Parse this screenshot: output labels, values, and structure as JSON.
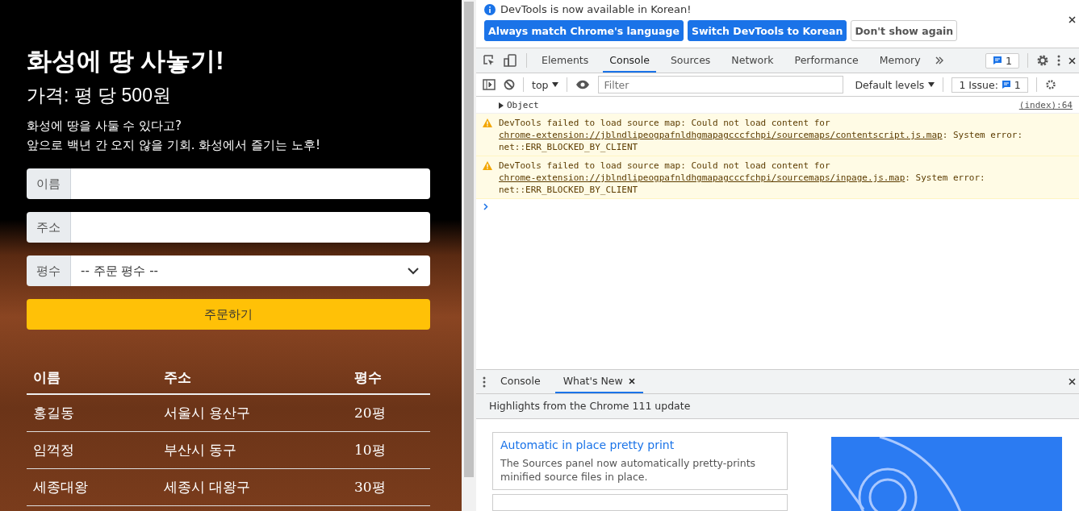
{
  "page": {
    "title": "화성에 땅 사놓기!",
    "price": "가격: 평 당 500원",
    "intro_lines": [
      "화성에 땅을 사둘 수 있다고?",
      "앞으로 백년 간 오지 않을 기회. 화성에서 즐기는 노후!"
    ],
    "fields": [
      {
        "kind": "text",
        "label": "이름"
      },
      {
        "kind": "text",
        "label": "주소"
      },
      {
        "kind": "select",
        "label": "평수",
        "value": "-- 주문 평수 --"
      }
    ],
    "submit_button": "주문하기",
    "table": {
      "columns": [
        "이름",
        "주소",
        "평수"
      ],
      "rows": [
        [
          "홍길동",
          "서울시 용산구",
          "20평"
        ],
        [
          "임꺽정",
          "부산시 동구",
          "10평"
        ],
        [
          "세종대왕",
          "세종시 대왕구",
          "30평"
        ]
      ]
    }
  },
  "devtools": {
    "banner": {
      "message": "DevTools is now available in Korean!",
      "buttons": [
        {
          "label": "Always match Chrome's language",
          "kind": "primary"
        },
        {
          "label": "Switch DevTools to Korean",
          "kind": "primary"
        },
        {
          "label": "Don't show again",
          "kind": "secondary"
        }
      ]
    },
    "tabs": [
      {
        "label": "Elements",
        "selected": false
      },
      {
        "label": "Console",
        "selected": true
      },
      {
        "label": "Sources",
        "selected": false
      },
      {
        "label": "Network",
        "selected": false
      },
      {
        "label": "Performance",
        "selected": false
      },
      {
        "label": "Memory",
        "selected": false
      }
    ],
    "messages_badge": "1",
    "console_toolbar": {
      "context": "top",
      "filter_placeholder": "Filter",
      "levels": "Default levels",
      "issues_label": "1 Issue:",
      "issues_count": "1"
    },
    "messages": [
      {
        "kind": "log",
        "text": "Object",
        "source": "(index):64"
      },
      {
        "kind": "warning",
        "text": "DevTools failed to load source map: Could not load content for ",
        "link": "chrome-extension://jblndlipeogpafnldhgmapagcccfchpi/sourcemaps/contentscript.js.map",
        "after": ": System error: net::ERR_BLOCKED_BY_CLIENT"
      },
      {
        "kind": "warning",
        "text": "DevTools failed to load source map: Could not load content for ",
        "link": "chrome-extension://jblndlipeogpafnldhgmapagcccfchpi/sourcemaps/inpage.js.map",
        "after": ": System error: net::ERR_BLOCKED_BY_CLIENT"
      }
    ],
    "drawer": {
      "tabs": [
        {
          "label": "Console",
          "selected": false,
          "closable": false
        },
        {
          "label": "What's New",
          "selected": true,
          "closable": true
        }
      ],
      "header": "Highlights from the Chrome 111 update",
      "cards": [
        {
          "title": "Automatic in place pretty print",
          "body": "The Sources panel now automatically pretty-prints minified source files in place."
        }
      ]
    }
  }
}
